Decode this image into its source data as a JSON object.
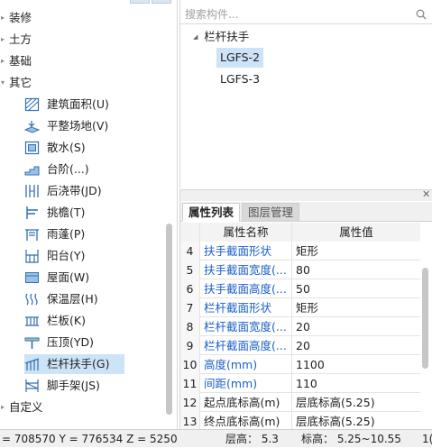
{
  "tree": {
    "categories": [
      {
        "label": "装修",
        "arrow": "▸"
      },
      {
        "label": "土方",
        "arrow": "▸"
      },
      {
        "label": "基础",
        "arrow": "▸"
      },
      {
        "label": "其它",
        "arrow": "▾"
      },
      {
        "label": "自定义",
        "arrow": "▸"
      }
    ],
    "items": [
      {
        "label": "建筑面积(U)",
        "icon": "area-icon"
      },
      {
        "label": "平整场地(V)",
        "icon": "level-ground-icon"
      },
      {
        "label": "散水(S)",
        "icon": "apron-icon"
      },
      {
        "label": "台阶(...)",
        "icon": "step-icon"
      },
      {
        "label": "后浇带(JD)",
        "icon": "post-cast-strip-icon"
      },
      {
        "label": "挑檐(T)",
        "icon": "cornice-icon"
      },
      {
        "label": "雨蓬(P)",
        "icon": "canopy-icon"
      },
      {
        "label": "阳台(Y)",
        "icon": "balcony-icon"
      },
      {
        "label": "屋面(W)",
        "icon": "roof-icon"
      },
      {
        "label": "保温层(H)",
        "icon": "insulation-icon"
      },
      {
        "label": "栏板(K)",
        "icon": "parapet-icon"
      },
      {
        "label": "压顶(YD)",
        "icon": "coping-icon"
      },
      {
        "label": "栏杆扶手(G)",
        "icon": "railing-icon",
        "selected": true
      },
      {
        "label": "脚手架(JS)",
        "icon": "scaffold-icon"
      }
    ]
  },
  "component_list": {
    "search_placeholder": "搜索构件...",
    "root_label": "栏杆扶手",
    "root_arrow": "◢",
    "items": [
      {
        "label": "LGFS-2",
        "selected": true
      },
      {
        "label": "LGFS-3",
        "selected": false
      }
    ]
  },
  "properties": {
    "tabs": [
      "属性列表",
      "图层管理"
    ],
    "active_tab": "属性列表",
    "close_glyph": "✕",
    "headers": {
      "name": "属性名称",
      "value": "属性值"
    },
    "rows": [
      {
        "idx": "4",
        "name": "扶手截面形状",
        "value": "矩形",
        "blue": true
      },
      {
        "idx": "5",
        "name": "扶手截面宽度(...",
        "value": "80",
        "blue": true
      },
      {
        "idx": "6",
        "name": "扶手截面高度(...",
        "value": "50",
        "blue": true
      },
      {
        "idx": "7",
        "name": "栏杆截面形状",
        "value": "矩形",
        "blue": true
      },
      {
        "idx": "8",
        "name": "栏杆截面宽度(...",
        "value": "20",
        "blue": true
      },
      {
        "idx": "9",
        "name": "栏杆截面高度(...",
        "value": "20",
        "blue": true
      },
      {
        "idx": "10",
        "name": "高度(mm)",
        "value": "1100",
        "blue": true
      },
      {
        "idx": "11",
        "name": "间距(mm)",
        "value": "110",
        "blue": true
      },
      {
        "idx": "12",
        "name": "起点底标高(m)",
        "value": "层底标高(5.25)",
        "blue": false
      },
      {
        "idx": "13",
        "name": "终点底标高(m)",
        "value": "层底标高(5.25)",
        "blue": false
      }
    ]
  },
  "status": {
    "coords": "= 708570 Y = 776534 Z = 5250",
    "floor_height": "层高： 5.3",
    "elevation": "标高： 5.25~10.55",
    "tail": "1("
  },
  "colors": {
    "selection": "#cde3f7",
    "link_blue": "#1a5fc9",
    "icon_blue": "#2f6fb3"
  }
}
